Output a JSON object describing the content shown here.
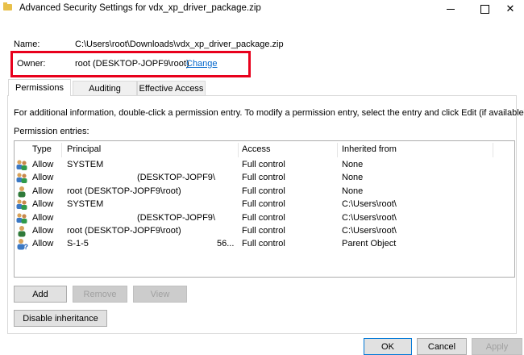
{
  "window": {
    "title": "Advanced Security Settings for vdx_xp_driver_package.zip",
    "close_glyph": "✕"
  },
  "name": {
    "label": "Name:",
    "value": "C:\\Users\\root\\Downloads\\vdx_xp_driver_package.zip"
  },
  "owner": {
    "label": "Owner:",
    "value": "root (DESKTOP-JOPF9\\root)",
    "change_link": "Change",
    "highlight_color": "#e8001c"
  },
  "tabs": [
    {
      "label": "Permissions",
      "active": true
    },
    {
      "label": "Auditing",
      "active": false
    },
    {
      "label": "Effective Access",
      "active": false
    }
  ],
  "info_text": "For additional information, double-click a permission entry. To modify a permission entry, select the entry and click Edit (if available).",
  "entries_label": "Permission entries:",
  "columns": {
    "type": "Type",
    "principal": "Principal",
    "access": "Access",
    "inherited": "Inherited from"
  },
  "entries": [
    {
      "icon": "group-icon",
      "type": "Allow",
      "principal": "SYSTEM",
      "principal_suffix": "",
      "access": "Full control",
      "inherited": "None"
    },
    {
      "icon": "group-icon",
      "type": "Allow",
      "principal": "(DESKTOP-JOPF9\\",
      "principal_suffix": "",
      "access": "Full control",
      "inherited": "None"
    },
    {
      "icon": "user-icon",
      "type": "Allow",
      "principal": "root (DESKTOP-JOPF9\\root)",
      "principal_suffix": "",
      "access": "Full control",
      "inherited": "None"
    },
    {
      "icon": "group-icon",
      "type": "Allow",
      "principal": "SYSTEM",
      "principal_suffix": "",
      "access": "Full control",
      "inherited": "C:\\Users\\root\\"
    },
    {
      "icon": "group-icon",
      "type": "Allow",
      "principal": "(DESKTOP-JOPF9\\",
      "principal_suffix": "",
      "access": "Full control",
      "inherited": "C:\\Users\\root\\"
    },
    {
      "icon": "user-icon",
      "type": "Allow",
      "principal": "root (DESKTOP-JOPF9\\root)",
      "principal_suffix": "",
      "access": "Full control",
      "inherited": "C:\\Users\\root\\"
    },
    {
      "icon": "unknown-user-icon",
      "type": "Allow",
      "principal": "S-1-5",
      "principal_suffix": "56...",
      "access": "Full control",
      "inherited": "Parent Object"
    }
  ],
  "buttons": {
    "add": "Add",
    "remove": "Remove",
    "view": "View",
    "disable_inheritance": "Disable inheritance",
    "ok": "OK",
    "cancel": "Cancel",
    "apply": "Apply"
  }
}
